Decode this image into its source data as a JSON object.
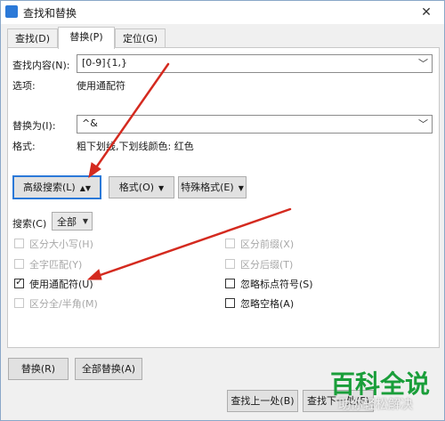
{
  "window": {
    "title": "查找和替换",
    "close_glyph": "✕",
    "accent": "#2b79d8",
    "annotation_color": "#d42a1f"
  },
  "tabs": [
    {
      "label": "查找(D)",
      "active": false
    },
    {
      "label": "替换(P)",
      "active": true
    },
    {
      "label": "定位(G)",
      "active": false
    }
  ],
  "find": {
    "label": "查找内容(N):",
    "value": "[0-9]{1,}",
    "options_label": "选项:",
    "options_value": "使用通配符"
  },
  "replace": {
    "label": "替换为(I):",
    "value": "^&",
    "format_label": "格式:",
    "format_value": "粗下划线,下划线颜色: 红色"
  },
  "buttons": {
    "advanced": "高级搜索(L)",
    "format": "格式(O)",
    "special": "特殊格式(E)",
    "replace": "替换(R)",
    "replace_all": "全部替换(A)",
    "find_prev": "查找上一处(B)",
    "find_next": "查找下一处(F)"
  },
  "search": {
    "label": "搜索(C)",
    "value": "全部"
  },
  "checkboxes": {
    "match_case": {
      "label": "区分大小写(H)",
      "checked": false,
      "enabled": false
    },
    "whole_word": {
      "label": "全字匹配(Y)",
      "checked": false,
      "enabled": false
    },
    "wildcards": {
      "label": "使用通配符(U)",
      "checked": true,
      "enabled": true
    },
    "width": {
      "label": "区分全/半角(M)",
      "checked": false,
      "enabled": false
    },
    "prefix": {
      "label": "区分前缀(X)",
      "checked": false,
      "enabled": false
    },
    "suffix": {
      "label": "区分后缀(T)",
      "checked": false,
      "enabled": false
    },
    "ignore_punct": {
      "label": "忽略标点符号(S)",
      "checked": false,
      "enabled": true
    },
    "ignore_space": {
      "label": "忽略空格(A)",
      "checked": false,
      "enabled": true
    }
  },
  "watermark": {
    "brand": "百科全说",
    "tagline": "助你轻松解决"
  }
}
